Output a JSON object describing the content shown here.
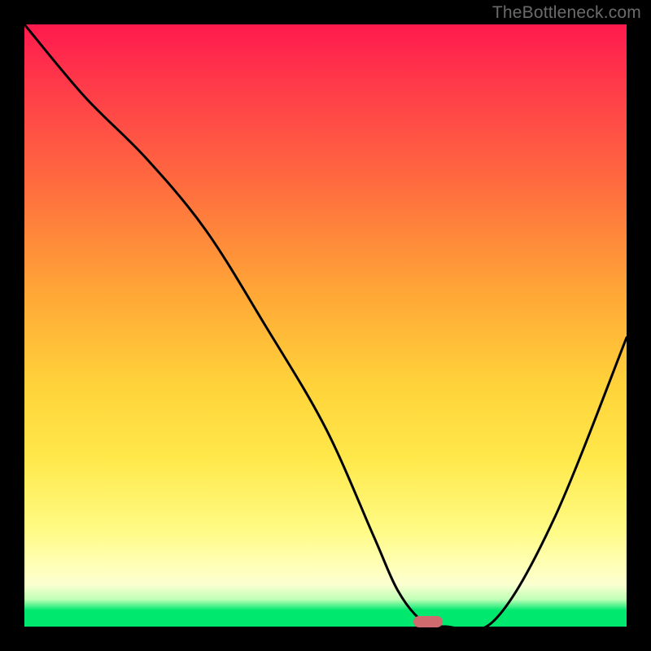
{
  "watermark": "TheBottleneck.com",
  "colors": {
    "frame_bg": "#000000",
    "watermark_text": "#6b6b6b",
    "curve_stroke": "#000000",
    "marker_fill": "#cf6a6f",
    "gradient_stops": [
      "#ff1a4d",
      "#ff3a4a",
      "#ff6a3f",
      "#ffa836",
      "#ffd33a",
      "#ffe84a",
      "#fffb85",
      "#ffffb8",
      "#fbffd0",
      "#bfffb7",
      "#00e86e"
    ]
  },
  "chart_data": {
    "type": "line",
    "title": "",
    "xlabel": "",
    "ylabel": "",
    "xlim": [
      0,
      100
    ],
    "ylim": [
      0,
      100
    ],
    "series": [
      {
        "name": "bottleneck-curve",
        "x": [
          0,
          10,
          20,
          30,
          40,
          50,
          58,
          62,
          66,
          70,
          78,
          88,
          100
        ],
        "y": [
          100,
          88,
          78,
          66,
          50,
          33,
          15,
          6,
          1,
          0,
          1,
          18,
          48
        ]
      }
    ],
    "optimum_marker": {
      "x": 67,
      "y": 0.5
    },
    "note": "x/y are percentages of the plot area; y=100 is top, y=0 is bottom (green band). Values estimated from pixels."
  }
}
